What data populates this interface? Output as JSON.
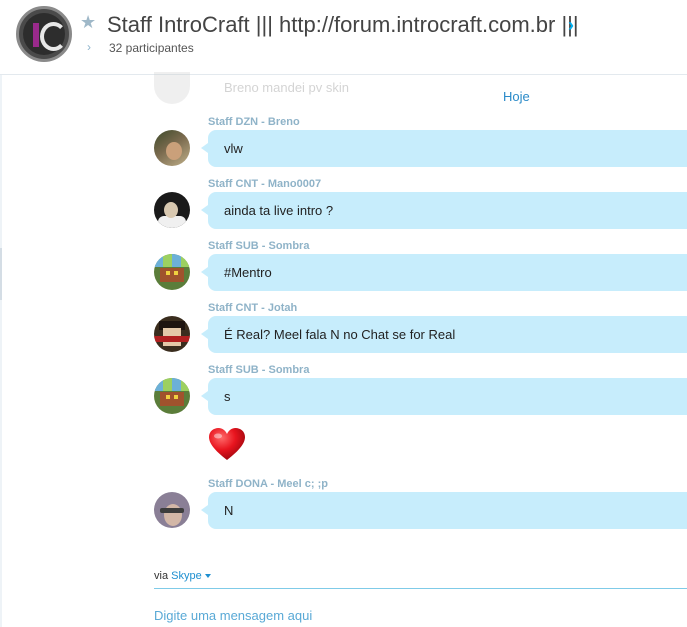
{
  "colors": {
    "accent": "#00aff0",
    "bubble": "#c7edfc",
    "sender": "#8fb3c8",
    "link": "#2a8ac8"
  },
  "conversation": {
    "avatar_initials": "IC",
    "title": "Staff IntroCraft ||| http://forum.introcraft.com.br |||",
    "participants": "32 participantes"
  },
  "faded_message": {
    "text": "Breno mandei pv skin"
  },
  "date_separator": "Hoje",
  "messages": [
    {
      "sender": "Staff DZN - Breno",
      "text": "vlw",
      "avatar_icon": "user-avatar-breno"
    },
    {
      "sender": "Staff CNT - Mano0007",
      "text": "ainda ta live intro ?",
      "avatar_icon": "user-avatar-mano0007"
    },
    {
      "sender": "Staff SUB - Sombra",
      "text": "#Mentro",
      "avatar_icon": "user-avatar-sombra"
    },
    {
      "sender": "Staff CNT - Jotah",
      "text": "É Real? Meel fala N no Chat se for Real",
      "avatar_icon": "user-avatar-jotah"
    },
    {
      "sender": "Staff SUB - Sombra",
      "text": "s",
      "avatar_icon": "user-avatar-sombra"
    },
    {
      "sender": "Staff DONA - Meel c; ;p",
      "text": "N",
      "avatar_icon": "user-avatar-meel"
    }
  ],
  "emoticon": {
    "icon": "heart-icon",
    "color": "#e8141e"
  },
  "composer": {
    "via_label": "via",
    "service": "Skype",
    "placeholder": "Digite uma mensagem aqui"
  }
}
